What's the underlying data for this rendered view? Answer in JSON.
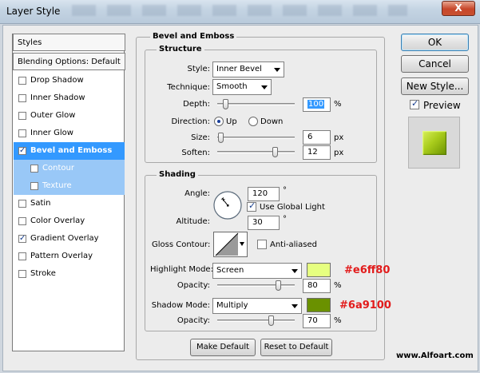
{
  "window": {
    "title": "Layer Style",
    "close_label": "X"
  },
  "sidebar": {
    "header": "Styles",
    "blending": "Blending Options: Default",
    "items": [
      {
        "label": "Drop Shadow",
        "checked": false
      },
      {
        "label": "Inner Shadow",
        "checked": false
      },
      {
        "label": "Outer Glow",
        "checked": false
      },
      {
        "label": "Inner Glow",
        "checked": false
      },
      {
        "label": "Bevel and Emboss",
        "checked": true
      },
      {
        "label": "Contour",
        "checked": false
      },
      {
        "label": "Texture",
        "checked": false
      },
      {
        "label": "Satin",
        "checked": false
      },
      {
        "label": "Color Overlay",
        "checked": false
      },
      {
        "label": "Gradient Overlay",
        "checked": true
      },
      {
        "label": "Pattern Overlay",
        "checked": false
      },
      {
        "label": "Stroke",
        "checked": false
      }
    ]
  },
  "bevel": {
    "title": "Bevel and Emboss",
    "structure": {
      "title": "Structure",
      "style_label": "Style:",
      "style_value": "Inner Bevel",
      "technique_label": "Technique:",
      "technique_value": "Smooth",
      "depth_label": "Depth:",
      "depth_value": "100",
      "depth_unit": "%",
      "direction_label": "Direction:",
      "direction_up": "Up",
      "direction_down": "Down",
      "size_label": "Size:",
      "size_value": "6",
      "size_unit": "px",
      "soften_label": "Soften:",
      "soften_value": "12",
      "soften_unit": "px"
    },
    "shading": {
      "title": "Shading",
      "angle_label": "Angle:",
      "angle_value": "120",
      "degree": "°",
      "use_global_light": "Use Global Light",
      "altitude_label": "Altitude:",
      "altitude_value": "30",
      "gloss_label": "Gloss Contour:",
      "anti_aliased": "Anti-aliased",
      "highlight_label": "Highlight Mode:",
      "highlight_mode": "Screen",
      "highlight_color": "#e6ff80",
      "highlight_hex": "#e6ff80",
      "highlight_opacity_label": "Opacity:",
      "highlight_opacity": "80",
      "shadow_label": "Shadow Mode:",
      "shadow_mode": "Multiply",
      "shadow_color": "#6a9100",
      "shadow_hex": "#6a9100",
      "shadow_opacity_label": "Opacity:",
      "shadow_opacity": "70",
      "percent": "%"
    },
    "make_default": "Make Default",
    "reset_default": "Reset to Default"
  },
  "right": {
    "ok": "OK",
    "cancel": "Cancel",
    "new_style": "New Style...",
    "preview": "Preview"
  },
  "watermark": "www.Alfoart.com"
}
